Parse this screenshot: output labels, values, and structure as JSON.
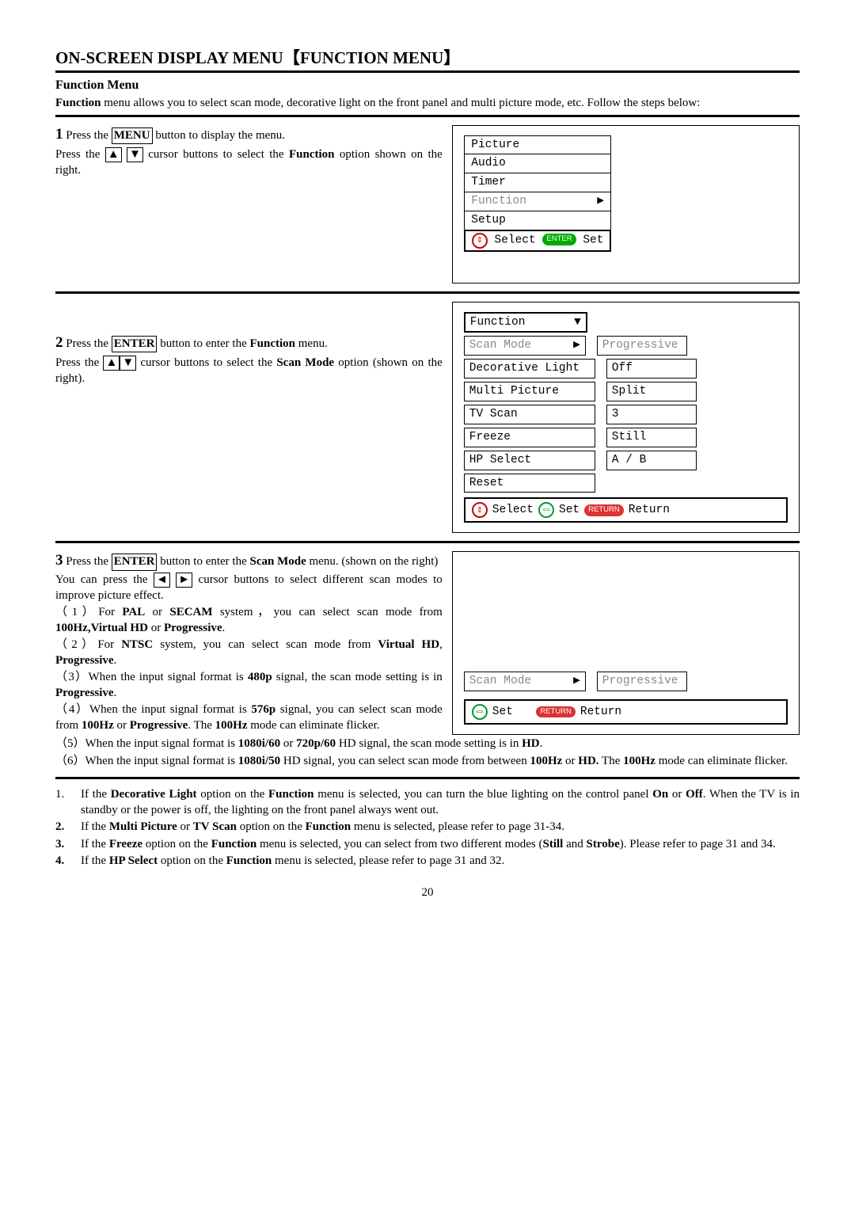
{
  "title": "ON-SCREEN DISPLAY MENU【FUNCTION MENU】",
  "subtitle": "Function Menu",
  "intro": "Function menu allows you to select scan mode, decorative light on the front panel and multi picture mode, etc. Follow the steps below:",
  "step1": {
    "num": "1",
    "a": " Press the ",
    "b": " button to display the menu.",
    "c": "Press the ",
    "d": " cursor buttons to select the ",
    "e": " option shown on the right.",
    "menu_btn": "MENU",
    "func_word": "Function"
  },
  "menu1": {
    "items": [
      "Picture",
      "Audio",
      "Timer",
      "Function",
      "Setup"
    ],
    "footer_select": "Select",
    "footer_set": "Set",
    "enter_pill": "ENTER"
  },
  "step2": {
    "num": "2",
    "a": " Press the ",
    "b": " button to enter the ",
    "c": " menu.",
    "d": "Press the ",
    "e": " cursor buttons to select the ",
    "f": " option (shown on the right).",
    "enter_btn": "ENTER",
    "func_word": "Function",
    "scan_word": "Scan Mode"
  },
  "menu2": {
    "header": "Function",
    "rows": [
      {
        "label": "Scan Mode",
        "val": "Progressive",
        "sel": true
      },
      {
        "label": "Decorative Light",
        "val": "Off"
      },
      {
        "label": "Multi Picture",
        "val": "Split"
      },
      {
        "label": "TV Scan",
        "val": "3"
      },
      {
        "label": "Freeze",
        "val": "Still"
      },
      {
        "label": "HP Select",
        "val": "A / B"
      },
      {
        "label": "Reset",
        "val": null
      }
    ],
    "footer": {
      "select": "Select",
      "set": "Set",
      "return": "Return",
      "return_pill": "RETURN"
    }
  },
  "step3": {
    "num": "3",
    "a": " Press the ",
    "b": " button to enter the ",
    "c": " menu. (shown on the right)",
    "d": "You can press the ",
    "e": " cursor buttons to select different scan modes to improve picture effect.",
    "enter_btn": "ENTER",
    "scan_word": "Scan Mode",
    "items": [
      "（1）For PAL or SECAM system，you can select scan mode from 100Hz,Virtual HD or Progressive.",
      "（2）For NTSC system, you can select scan mode from Virtual HD, Progressive.",
      "（3）When the input signal format is 480p signal, the scan mode setting is in Progressive.",
      "（4）When the input signal format is 576p signal, you can select scan mode from 100Hz or Progressive. The 100Hz mode can eliminate flicker.",
      "（5）When the input signal format is 1080i/60 or 720p/60 HD signal, the scan mode setting is in HD.",
      "（6）When the input signal format is 1080i/50 HD signal, you can select scan mode from between 100Hz or HD. The 100Hz mode can eliminate flicker."
    ]
  },
  "menu3": {
    "label": "Scan Mode",
    "val": "Progressive",
    "set": "Set",
    "return": "Return",
    "return_pill": "RETURN"
  },
  "notes": [
    "If the Decorative Light option on the Function menu is selected, you can turn the blue lighting on the control panel On or Off. When the TV is in standby or the power is off, the lighting on the front panel always went out.",
    "If the Multi Picture or TV Scan option on the Function menu is selected, please refer to page 31-34.",
    "If the Freeze option on the Function menu is selected, you can select from two different modes (Still and Strobe). Please refer to page 31 and 34.",
    "If the HP Select option on the Function menu is selected, please refer to page 31 and 32."
  ],
  "page_num": "20"
}
